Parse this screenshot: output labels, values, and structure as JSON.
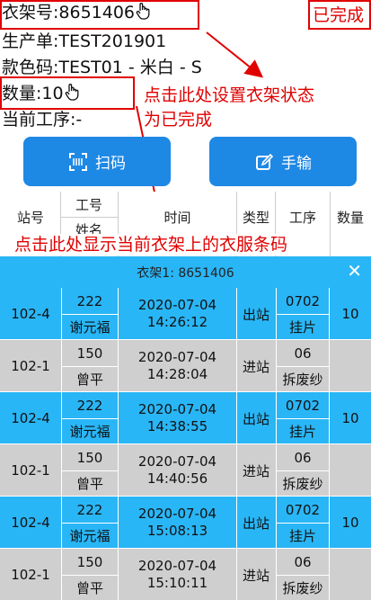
{
  "header": {
    "rack_label": "衣架号:8651406",
    "order_label": "生产单:TEST201901",
    "style_label": "款色码:TEST01 - 米白 - S",
    "qty_label": "数量:10",
    "process_label": "当前工序:-",
    "status": "已完成"
  },
  "annotations": {
    "set_complete": "点击此处设置衣架状态",
    "set_complete_line2": "为已完成",
    "show_barcodes": "点击此处显示当前衣架上的衣服条码"
  },
  "buttons": {
    "scan": "扫码",
    "manual": "手输"
  },
  "table": {
    "headers": {
      "station": "站号",
      "worker_id": "工号",
      "worker_name": "姓名",
      "time": "时间",
      "type": "类型",
      "process": "工序",
      "qty": "数量"
    },
    "group_label": "衣架1: 8651406",
    "rows": [
      {
        "station": "102-4",
        "worker_id": "222",
        "worker_name": "谢元福",
        "date": "2020-07-04",
        "clock": "14:26:12",
        "type": "出站",
        "proc_code": "0702",
        "proc_name": "挂片",
        "qty": "10",
        "kind": "out"
      },
      {
        "station": "102-1",
        "worker_id": "150",
        "worker_name": "曾平",
        "date": "2020-07-04",
        "clock": "14:28:04",
        "type": "进站",
        "proc_code": "06",
        "proc_name": "拆废纱",
        "qty": "",
        "kind": "in"
      },
      {
        "station": "102-4",
        "worker_id": "222",
        "worker_name": "谢元福",
        "date": "2020-07-04",
        "clock": "14:38:55",
        "type": "出站",
        "proc_code": "0702",
        "proc_name": "挂片",
        "qty": "10",
        "kind": "out"
      },
      {
        "station": "102-1",
        "worker_id": "150",
        "worker_name": "曾平",
        "date": "2020-07-04",
        "clock": "14:40:56",
        "type": "进站",
        "proc_code": "06",
        "proc_name": "拆废纱",
        "qty": "",
        "kind": "in"
      },
      {
        "station": "102-4",
        "worker_id": "222",
        "worker_name": "谢元福",
        "date": "2020-07-04",
        "clock": "15:08:13",
        "type": "出站",
        "proc_code": "0702",
        "proc_name": "挂片",
        "qty": "10",
        "kind": "out"
      },
      {
        "station": "102-1",
        "worker_id": "150",
        "worker_name": "曾平",
        "date": "2020-07-04",
        "clock": "15:10:11",
        "type": "进站",
        "proc_code": "06",
        "proc_name": "拆废纱",
        "qty": "",
        "kind": "in"
      }
    ]
  },
  "colors": {
    "accent": "#1e88e5",
    "out_row": "#29b6f6",
    "in_row": "#cfcfcf",
    "annotation": "#e00000"
  },
  "icons": {
    "hand": "pointing-hand-icon",
    "scan": "scan-icon",
    "edit": "edit-icon",
    "close": "close-icon"
  }
}
